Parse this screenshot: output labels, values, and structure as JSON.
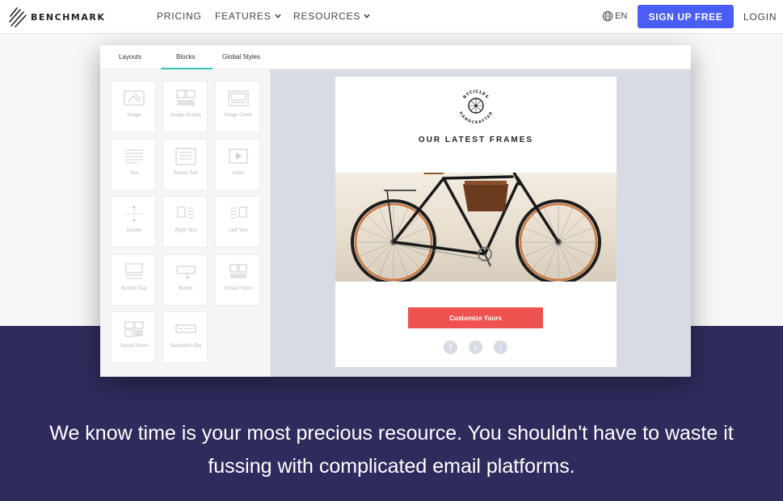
{
  "header": {
    "logo_text": "BENCHMARK",
    "nav": [
      {
        "label": "PRICING"
      },
      {
        "label": "FEATURES"
      },
      {
        "label": "RESOURCES"
      }
    ],
    "lang": "EN",
    "signup_label": "SIGN UP FREE",
    "login_label": "LOGIN"
  },
  "editor": {
    "tabs": [
      "Layouts",
      "Blocks",
      "Global Styles"
    ],
    "active_tab": "Blocks",
    "blocks": [
      "Image",
      "Image Groups",
      "Image Cards",
      "Text",
      "Boxed Text",
      "Video",
      "Divider",
      "Right Text",
      "Left Text",
      "Bottom Text",
      "Button",
      "Social Follow",
      "Social Share",
      "Navigation Bar"
    ],
    "email": {
      "badge_top": "BYCICLES",
      "badge_bottom": "HANDCRAFTED",
      "headline": "OUR LATEST FRAMES",
      "cta_label": "Customize Yours",
      "social": [
        "f",
        "t",
        "i"
      ]
    }
  },
  "tagline": "We know time is your most precious resource. You shouldn't have to waste it fussing with complicated email platforms.",
  "colors": {
    "brand_blue": "#4a5df5",
    "band": "#2f2c5d",
    "tab_accent": "#37c3b6",
    "cta": "#ef5350"
  }
}
